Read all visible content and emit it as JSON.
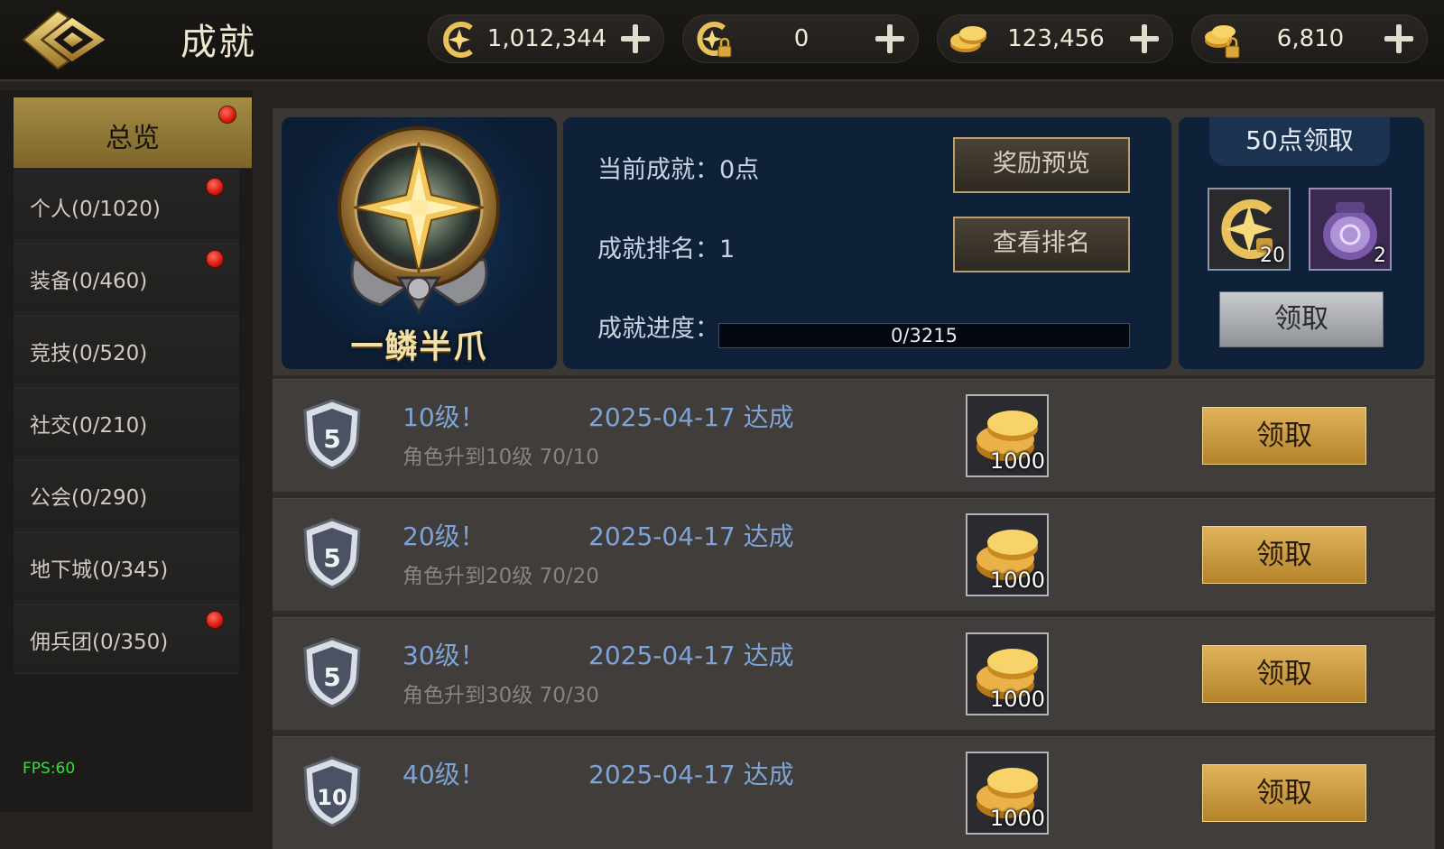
{
  "header": {
    "title": "成就",
    "resources": [
      {
        "name": "crest-coin",
        "value": "1,012,344"
      },
      {
        "name": "locked-crest-coin",
        "value": "0"
      },
      {
        "name": "gold-coins",
        "value": "123,456"
      },
      {
        "name": "locked-gold-coins",
        "value": "6,810"
      }
    ]
  },
  "sidebar": {
    "items": [
      {
        "label": "总览",
        "active": true,
        "alert": true
      },
      {
        "label": "个人(0/1020)",
        "alert": true
      },
      {
        "label": "装备(0/460)",
        "alert": true
      },
      {
        "label": "竞技(0/520)",
        "alert": false
      },
      {
        "label": "社交(0/210)",
        "alert": false
      },
      {
        "label": "公会(0/290)",
        "alert": false
      },
      {
        "label": "地下城(0/345)",
        "alert": false
      },
      {
        "label": "佣兵团(0/350)",
        "alert": true
      }
    ],
    "fps": "FPS:60"
  },
  "overview": {
    "badge_title": "一鳞半爪",
    "current_points": "当前成就：0点",
    "rank": "成就排名：1",
    "progress_label": "成就进度：",
    "progress_text": "0/3215",
    "progress_fraction": 0,
    "preview_button": "奖励预览",
    "rank_button": "查看排名",
    "milestone_title": "50点领取",
    "milestone_items": [
      {
        "icon": "crest-coin-icon",
        "qty": "20"
      },
      {
        "icon": "purple-jar-icon",
        "qty": "2"
      }
    ],
    "claim_button": "领取"
  },
  "achievements": [
    {
      "shield": "5",
      "name": "10级！",
      "date": "2025-04-17 达成",
      "desc": "角色升到10级 70/10",
      "reward_qty": "1000",
      "button": "领取"
    },
    {
      "shield": "5",
      "name": "20级！",
      "date": "2025-04-17 达成",
      "desc": "角色升到20级 70/20",
      "reward_qty": "1000",
      "button": "领取"
    },
    {
      "shield": "5",
      "name": "30级！",
      "date": "2025-04-17 达成",
      "desc": "角色升到30级 70/30",
      "reward_qty": "1000",
      "button": "领取"
    },
    {
      "shield": "10",
      "name": "40级！",
      "date": "2025-04-17 达成",
      "desc": "",
      "reward_qty": "1000",
      "button": "领取"
    }
  ],
  "colors": {
    "accent_gold": "#c89a45",
    "link_blue": "#7ea3d6",
    "alert_red": "#d81a0d",
    "panel_navy": "#0f2138"
  }
}
